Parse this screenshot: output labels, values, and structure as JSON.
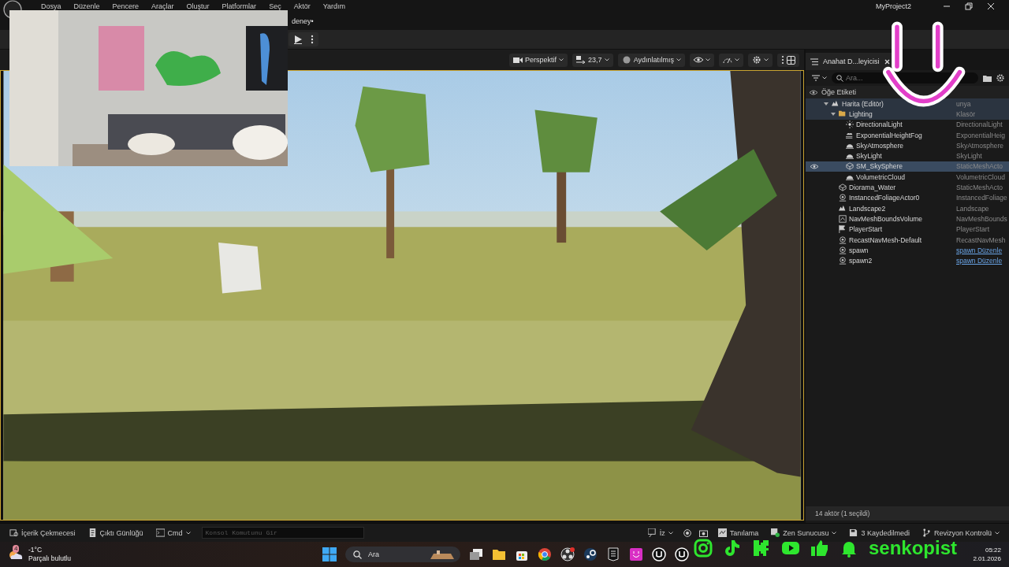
{
  "menu": [
    "Dosya",
    "Düzenle",
    "Pencere",
    "Araçlar",
    "Oluştur",
    "Platformlar",
    "Seç",
    "Aktör",
    "Yardım"
  ],
  "window_title": "MyProject2",
  "document_tab": {
    "label": "deney•"
  },
  "viewport_toolbar": {
    "view_mode": "Perspektif",
    "camera_speed": "23,7",
    "lighting": "Aydınlatılmış"
  },
  "outliner": {
    "tab": "Anahat D...leyicisi",
    "search_placeholder": "Ara...",
    "column": "Öğe Etiketi",
    "items": [
      {
        "label": "Harita (Editör)",
        "type": "unya",
        "kind": "map",
        "selected": false,
        "children": [
          {
            "label": "Lighting",
            "type": "Klasör",
            "kind": "folder",
            "selected": false,
            "children": [
              {
                "label": "DirectionalLight",
                "type": "DirectionalLight",
                "kind": "light",
                "selected": false
              },
              {
                "label": "ExponentialHeightFog",
                "type": "ExponentialHeig",
                "kind": "fog",
                "selected": false
              },
              {
                "label": "SkyAtmosphere",
                "type": "SkyAtmosphere",
                "kind": "sky",
                "selected": false
              },
              {
                "label": "SkyLight",
                "type": "SkyLight",
                "kind": "sky",
                "selected": false
              },
              {
                "label": "SM_SkySphere",
                "type": "StaticMeshActo",
                "kind": "mesh",
                "selected": true
              },
              {
                "label": "VolumetricCloud",
                "type": "VolumetricCloud",
                "kind": "sky",
                "selected": false
              }
            ]
          },
          {
            "label": "Diorama_Water",
            "type": "StaticMeshActo",
            "kind": "mesh",
            "selected": false
          },
          {
            "label": "InstancedFoliageActor0",
            "type": "InstancedFoliage",
            "kind": "actor",
            "selected": false
          },
          {
            "label": "Landscape2",
            "type": "Landscape",
            "kind": "map",
            "selected": false
          },
          {
            "label": "NavMeshBoundsVolume",
            "type": "NavMeshBounds",
            "kind": "volume",
            "selected": false
          },
          {
            "label": "PlayerStart",
            "type": "PlayerStart",
            "kind": "flag",
            "selected": false
          },
          {
            "label": "RecastNavMesh-Default",
            "type": "RecastNavMesh",
            "kind": "actor",
            "selected": false
          },
          {
            "label": "spawn",
            "type": "spawn Düzenle",
            "type_link": true,
            "kind": "actor",
            "selected": false
          },
          {
            "label": "spawn2",
            "type": "spawn Düzenle",
            "type_link": true,
            "kind": "actor",
            "selected": false
          }
        ]
      }
    ],
    "footer": "14 aktör (1 seçildi)"
  },
  "status_bar": {
    "left": [
      {
        "label": "İçerik Çekmecesi",
        "kind": "drawer"
      },
      {
        "label": "Çıktı Günlüğü",
        "kind": "log"
      },
      {
        "label": "Cmd",
        "kind": "cmd"
      }
    ],
    "console_placeholder": "Konsol Komutunu Gir",
    "right": [
      {
        "label": "İz",
        "kind": "trace"
      },
      {
        "label": "Tanılama",
        "kind": "diag"
      },
      {
        "label": "Zen Sunucusu",
        "kind": "zen"
      },
      {
        "label": "3 Kaydedilmedi",
        "kind": "save"
      },
      {
        "label": "Revizyon Kontrolü",
        "kind": "vcs"
      }
    ]
  },
  "taskbar": {
    "weather": {
      "badge": "4",
      "temperature": "-1°C",
      "condition": "Parçalı bulutlu"
    },
    "search_placeholder": "Ara",
    "time": "05:22",
    "date": "2.01.2026"
  },
  "overlay": {
    "channel": "senkopist"
  }
}
